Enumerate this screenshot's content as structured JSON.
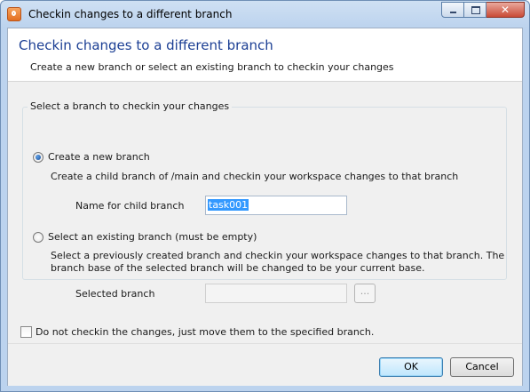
{
  "window": {
    "title": "Checkin changes to a different branch",
    "close_glyph": "✕"
  },
  "header": {
    "title": "Checkin changes to a different branch",
    "subtitle": "Create a new branch or select an existing branch to checkin your changes"
  },
  "group": {
    "title": "Select a branch to checkin your changes",
    "new_branch": {
      "label": "Create a new branch",
      "checked": true,
      "description": "Create a child branch of /main and checkin your workspace changes to that branch",
      "name_label": "Name for child branch",
      "name_value": "task001"
    },
    "existing_branch": {
      "label": "Select an existing branch (must be empty)",
      "checked": false,
      "description_line1": "Select a previously created branch and checkin your workspace changes to that branch. The",
      "description_line2": "branch base of the selected branch will be changed to be your current base.",
      "selected_label": "Selected branch",
      "selected_value": "",
      "browse_label": "..."
    }
  },
  "move_only": {
    "label": "Do not checkin the changes, just move them to the specified branch.",
    "checked": false
  },
  "buttons": {
    "ok": "OK",
    "cancel": "Cancel"
  },
  "icons": {
    "app": "plastic-scm-icon",
    "minimize": "minimize-icon",
    "maximize": "maximize-icon",
    "close": "close-icon"
  }
}
